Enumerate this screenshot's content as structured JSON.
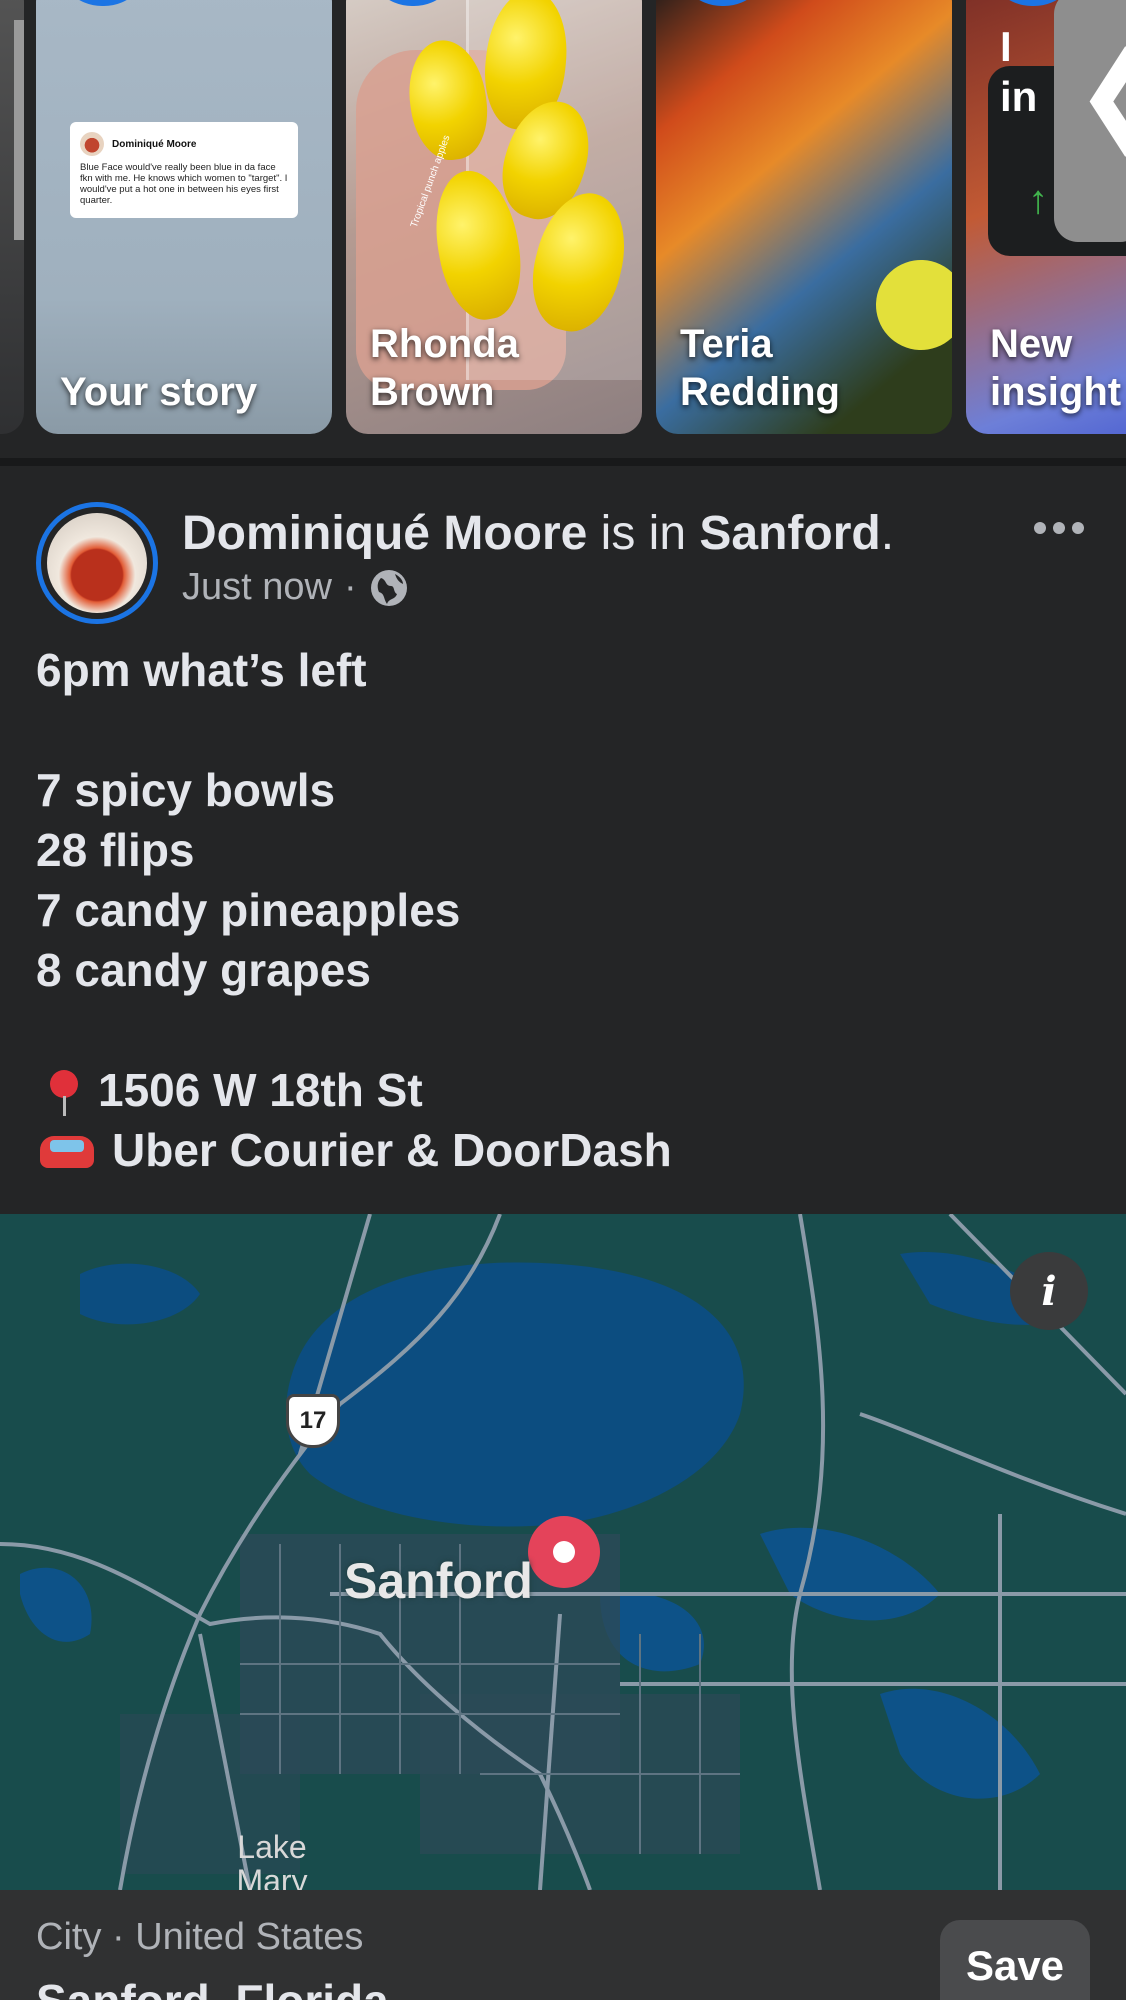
{
  "stories": {
    "your_story_label": "Your story",
    "your_story_quote": {
      "author": "Dominiqué Moore",
      "text": "Blue Face would've really been blue in da face fkn with me. He knows which women to \"target\". I would've put a hot one in between his eyes first quarter."
    },
    "story_1_name": "Rhonda Brown",
    "story_1_caption": "Tropical punch apples",
    "story_2_name": "Teria Redding",
    "story_3_name": "New insight",
    "story_3_partial_text": "I in",
    "story_3_arrow": "↑",
    "scroll_glyph": "❮"
  },
  "post": {
    "author": "Dominiqué Moore",
    "connector": " is in ",
    "place": "Sanford",
    "period": ".",
    "timestamp": "Just now",
    "separator": "·",
    "audience_icon": "globe-icon",
    "lines": {
      "l1": "6pm what’s left",
      "l2": "7 spicy bowls",
      "l3": "28 flips",
      "l4": "7 candy pineapples",
      "l5": "8 candy grapes",
      "l6": "1506 W 18th St",
      "l7": "Uber Courier & DoorDash"
    }
  },
  "map": {
    "highway_label": "17",
    "city_label": "Sanford",
    "town_label": "Lake Mary",
    "info_icon": "i",
    "colors": {
      "water": "#0c4d80",
      "land": "#184c4c",
      "urban": "#2c4a57",
      "road": "#8a9aa8",
      "pin": "#e4435a"
    }
  },
  "place": {
    "type": "City · United States",
    "name": "Sanford, Florida",
    "save_label": "Save"
  },
  "colors": {
    "background": "#242526",
    "accent": "#1b74e4",
    "text": "#e4e6eb",
    "muted": "#b0b3b8"
  }
}
